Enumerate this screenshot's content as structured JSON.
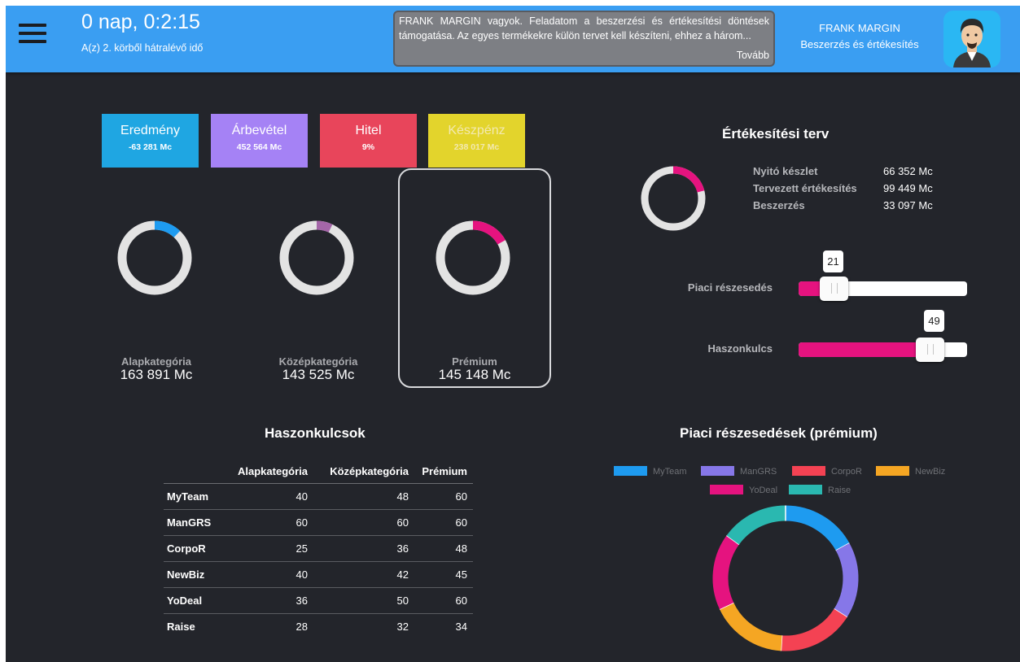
{
  "header": {
    "timer": "0 nap, 0:2:15",
    "timer_sub": "A(z) 2. körből hátralévő idő",
    "message": "FRANK MARGIN vagyok. Feladatom a beszerzési és értékesítési döntések támogatása. Az egyes termékekre külön tervet kell készíteni, ehhez a három...",
    "message_more": "Tovább",
    "user_name": "FRANK MARGIN",
    "user_role": "Beszerzés és értékesítés"
  },
  "kpis": [
    {
      "title": "Eredmény",
      "value": "-63 281 Mc"
    },
    {
      "title": "Árbevétel",
      "value": "452 564 Mc"
    },
    {
      "title": "Hitel",
      "value": "9%"
    },
    {
      "title": "Készpénz",
      "value": "238 017 Mc"
    }
  ],
  "categories": [
    {
      "name": "Alapkategória",
      "value": "163 891 Mc",
      "share": 0.12,
      "color": "#1e9bf0"
    },
    {
      "name": "Középkategória",
      "value": "143 525 Mc",
      "share": 0.07,
      "color": "#a466a8"
    },
    {
      "name": "Prémium",
      "value": "145 148 Mc",
      "share": 0.17,
      "color": "#e5137f",
      "selected": true
    }
  ],
  "sales_plan": {
    "title": "Értékesítési terv",
    "donut_share": 0.21,
    "donut_color": "#e5137f",
    "rows": [
      {
        "label": "Nyitó készlet",
        "value": "66 352 Mc"
      },
      {
        "label": "Tervezett értékesítés",
        "value": "99 449 Mc"
      },
      {
        "label": "Beszerzés",
        "value": "33 097 Mc"
      }
    ],
    "sliders": [
      {
        "label": "Piaci részesedés",
        "value": "21",
        "fraction": 0.21
      },
      {
        "label": "Haszonkulcs",
        "value": "49",
        "fraction": 0.82
      }
    ]
  },
  "margins": {
    "title": "Haszonkulcsok",
    "columns": [
      "Alapkategória",
      "Középkategória",
      "Prémium"
    ],
    "rows": [
      {
        "name": "MyTeam",
        "values": [
          "40",
          "48",
          "60"
        ]
      },
      {
        "name": "ManGRS",
        "values": [
          "60",
          "60",
          "60"
        ]
      },
      {
        "name": "CorpoR",
        "values": [
          "25",
          "36",
          "48"
        ]
      },
      {
        "name": "NewBiz",
        "values": [
          "40",
          "42",
          "45"
        ]
      },
      {
        "name": "YoDeal",
        "values": [
          "36",
          "50",
          "60"
        ]
      },
      {
        "name": "Raise",
        "values": [
          "28",
          "32",
          "34"
        ]
      }
    ]
  },
  "chart_data": {
    "type": "pie",
    "title": "Piaci részesedések (prémium)",
    "legend_position": "top",
    "categories": [
      "MyTeam",
      "ManGRS",
      "CorpoR",
      "NewBiz",
      "YoDeal",
      "Raise"
    ],
    "values": [
      17,
      17,
      17,
      17,
      17,
      15
    ],
    "colors": [
      "#1e9bf0",
      "#8677e8",
      "#f44253",
      "#f5a623",
      "#e5137f",
      "#2ab8b0"
    ]
  }
}
